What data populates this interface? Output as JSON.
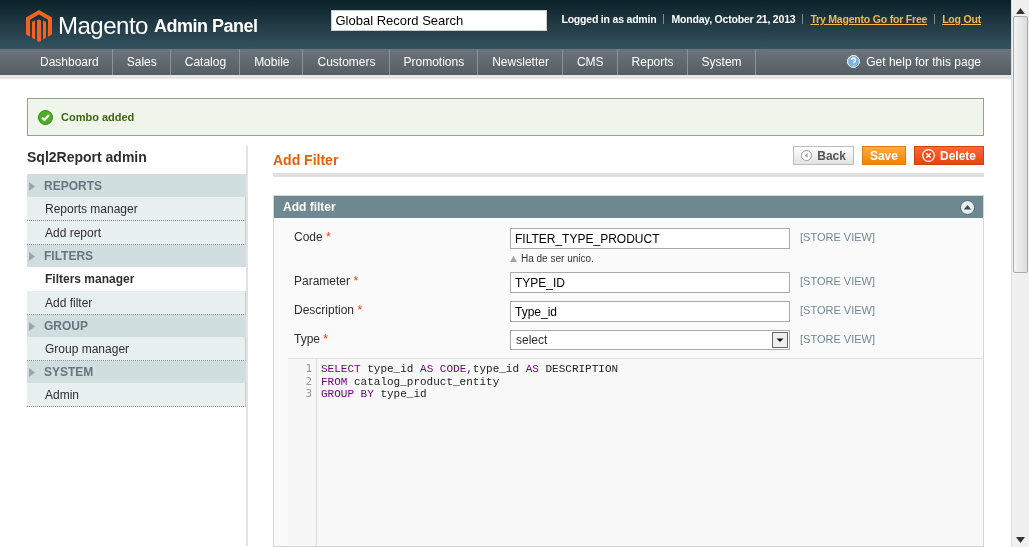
{
  "header": {
    "logo_text": "Magento",
    "logo_sub": "Admin Panel",
    "search": {
      "value": "Global Record Search"
    },
    "user": "Logged in as admin",
    "date": "Monday, October 21, 2013",
    "links": [
      "Try Magento Go for Free",
      "Log Out"
    ]
  },
  "nav": {
    "items": [
      "Dashboard",
      "Sales",
      "Catalog",
      "Mobile",
      "Customers",
      "Promotions",
      "Newsletter",
      "CMS",
      "Reports",
      "System"
    ],
    "help": "Get help for this page"
  },
  "message": {
    "kind": "success",
    "text": "Combo added"
  },
  "sidebar": {
    "title": "Sql2Report admin",
    "sections": [
      {
        "title": "REPORTS",
        "items": [
          {
            "label": "Reports manager",
            "selected": false
          },
          {
            "label": "Add report",
            "selected": false
          }
        ]
      },
      {
        "title": "FILTERS",
        "items": [
          {
            "label": "Filters manager",
            "selected": true
          },
          {
            "label": "Add filter",
            "selected": false
          }
        ]
      },
      {
        "title": "GROUP",
        "items": [
          {
            "label": "Group manager",
            "selected": false
          }
        ]
      },
      {
        "title": "SYSTEM",
        "items": [
          {
            "label": "Admin",
            "selected": false
          }
        ]
      }
    ]
  },
  "page": {
    "title": "Add Filter",
    "buttons": [
      {
        "kind": "back",
        "label": "Back"
      },
      {
        "kind": "save",
        "label": "Save"
      },
      {
        "kind": "delete",
        "label": "Delete"
      }
    ]
  },
  "form": {
    "title": "Add filter",
    "fields": [
      {
        "kind": "text",
        "label": "Code",
        "required": "*",
        "value": "FILTER_TYPE_PRODUCT",
        "note": "Ha de ser unico.",
        "scope": "[STORE VIEW]"
      },
      {
        "kind": "text",
        "label": "Parameter",
        "required": "*",
        "value": "TYPE_ID",
        "scope": "[STORE VIEW]"
      },
      {
        "kind": "text",
        "label": "Description",
        "required": "*",
        "value": "Type_id",
        "scope": "[STORE VIEW]"
      },
      {
        "kind": "select",
        "label": "Type",
        "required": "*",
        "value": "select",
        "scope": "[STORE VIEW]"
      }
    ],
    "code": [
      {
        "number": "1",
        "tokens": [
          {
            "kind": "keyword",
            "text": "SELECT"
          },
          {
            "kind": "plain",
            "text": " type_id "
          },
          {
            "kind": "keyword",
            "text": "AS CODE"
          },
          {
            "kind": "plain",
            "text": ",type_id "
          },
          {
            "kind": "keyword",
            "text": "AS"
          },
          {
            "kind": "plain",
            "text": " DESCRIPTION"
          }
        ]
      },
      {
        "number": "2",
        "tokens": [
          {
            "kind": "keyword",
            "text": "FROM"
          },
          {
            "kind": "plain",
            "text": " catalog_product_entity"
          }
        ]
      },
      {
        "number": "3",
        "tokens": [
          {
            "kind": "keyword",
            "text": "GROUP BY"
          },
          {
            "kind": "plain",
            "text": " type_id"
          }
        ]
      }
    ]
  }
}
